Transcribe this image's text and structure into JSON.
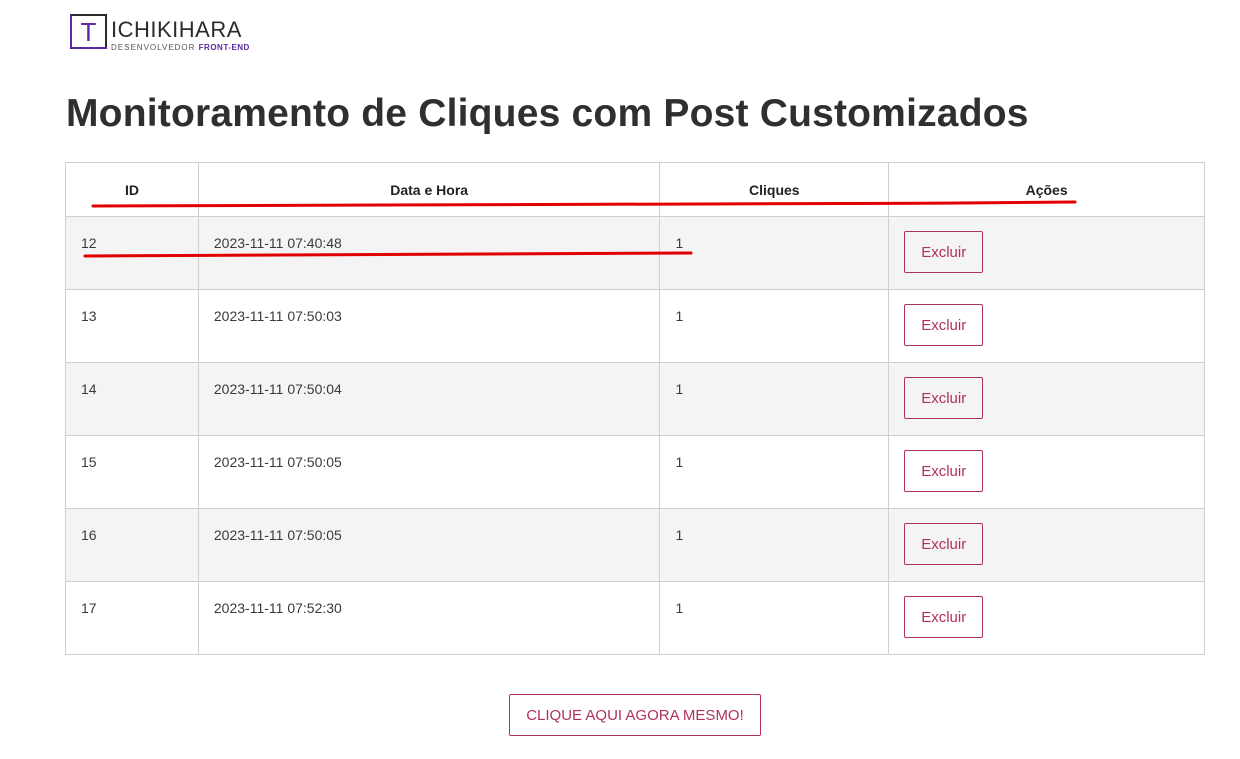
{
  "logo": {
    "mark": "T",
    "name": "ICHIKIHARA",
    "subtitle_prefix": "DESENVOLVEDOR",
    "subtitle_accent": "FRONT-END"
  },
  "page_title": "Monitoramento de Cliques com Post Customizados",
  "table": {
    "headers": {
      "id": "ID",
      "datetime": "Data e Hora",
      "clicks": "Cliques",
      "actions": "Ações"
    },
    "rows": [
      {
        "id": "12",
        "datetime": "2023-11-11 07:40:48",
        "clicks": "1",
        "action_label": "Excluir"
      },
      {
        "id": "13",
        "datetime": "2023-11-11 07:50:03",
        "clicks": "1",
        "action_label": "Excluir"
      },
      {
        "id": "14",
        "datetime": "2023-11-11 07:50:04",
        "clicks": "1",
        "action_label": "Excluir"
      },
      {
        "id": "15",
        "datetime": "2023-11-11 07:50:05",
        "clicks": "1",
        "action_label": "Excluir"
      },
      {
        "id": "16",
        "datetime": "2023-11-11 07:50:05",
        "clicks": "1",
        "action_label": "Excluir"
      },
      {
        "id": "17",
        "datetime": "2023-11-11 07:52:30",
        "clicks": "1",
        "action_label": "Excluir"
      }
    ]
  },
  "cta_label": "CLIQUE AQUI AGORA MESMO!",
  "colors": {
    "accent": "#b03060",
    "brand": "#5a2ca0",
    "annotation": "#e00000",
    "striped_row": "#f4f4f4"
  }
}
